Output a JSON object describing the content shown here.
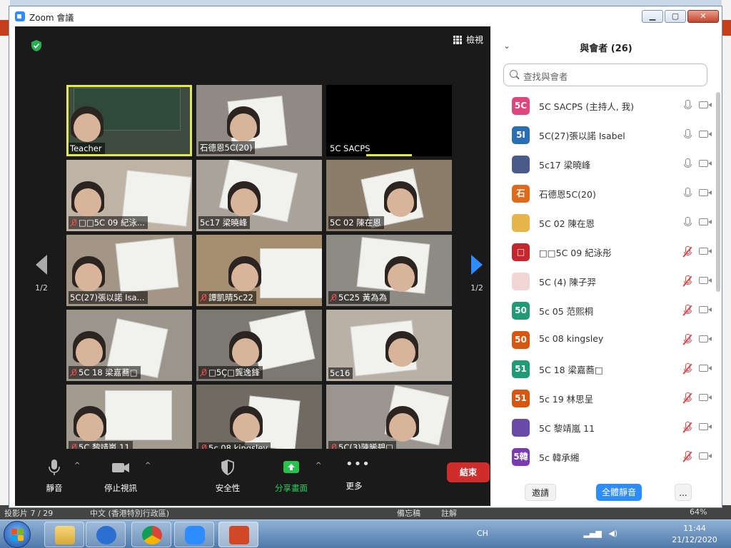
{
  "window": {
    "title": "Zoom 會議"
  },
  "stage": {
    "view_label": "檢視",
    "page_left": "1/2",
    "page_right": "1/2",
    "tiles": [
      {
        "name": "Teacher",
        "muted": false,
        "bg": "#3d4c3f"
      },
      {
        "name": "石德恩5C(20)",
        "muted": false,
        "bg": "#8f8a84"
      },
      {
        "name": "5C SACPS",
        "muted": false,
        "bg": "#000000"
      },
      {
        "name": "□□5C 09 紀泳...",
        "muted": true,
        "bg": "#bfb3a6"
      },
      {
        "name": "5c17 梁曉峰",
        "muted": false,
        "bg": "#a9a39a"
      },
      {
        "name": "5C 02 陳在恩",
        "muted": false,
        "bg": "#8c7c6a"
      },
      {
        "name": "5C(27)張以諾 Isa...",
        "muted": false,
        "bg": "#a49684"
      },
      {
        "name": "譚凱晴5c22",
        "muted": true,
        "bg": "#a68e70"
      },
      {
        "name": "5C25 黃為為",
        "muted": true,
        "bg": "#8d8b83"
      },
      {
        "name": "5C 18 梁嘉蕎□",
        "muted": true,
        "bg": "#9c958c"
      },
      {
        "name": "□5Ç□龔逸鋒",
        "muted": true,
        "bg": "#7c7872"
      },
      {
        "name": "5c16",
        "muted": false,
        "bg": "#b9b1a6"
      },
      {
        "name": "5C 黎靖嵐 11",
        "muted": true,
        "bg": "#a39a90"
      },
      {
        "name": "5c 08 kingsley",
        "muted": true,
        "bg": "#6f6a62"
      },
      {
        "name": "5C(3)陳晞碧□",
        "muted": true,
        "bg": "#9a958e"
      }
    ]
  },
  "toolbar": {
    "mute": "靜音",
    "stop_video": "停止視訊",
    "security": "安全性",
    "share": "分享畫面",
    "more": "更多",
    "end": "結束"
  },
  "panel": {
    "title": "與會者 (26)",
    "search_placeholder": "查找與會者",
    "participants": [
      {
        "avatar": "5C",
        "color": "#e0457b",
        "name": "5C SACPS (主持人, 我)",
        "muted": false
      },
      {
        "avatar": "5I",
        "color": "#2a6fb3",
        "name": "5C(27)張以諾 Isabel",
        "muted": false
      },
      {
        "avatar": "",
        "color": "#4a5a8a",
        "name": "5c17 梁曉峰",
        "muted": false
      },
      {
        "avatar": "石",
        "color": "#e06a1b",
        "name": "石德恩5C(20)",
        "muted": false
      },
      {
        "avatar": "",
        "color": "#e8b54a",
        "name": "5C 02 陳在恩",
        "muted": false
      },
      {
        "avatar": "□",
        "color": "#c8262e",
        "name": "□□5C 09 紀泳彤",
        "muted": true
      },
      {
        "avatar": "",
        "color": "#f2d6d6",
        "name": "5C (4) 陳子羿",
        "muted": true
      },
      {
        "avatar": "50",
        "color": "#1f9c75",
        "name": "5c 05 范熙桐",
        "muted": true
      },
      {
        "avatar": "50",
        "color": "#d8560f",
        "name": "5c 08 kingsley",
        "muted": true
      },
      {
        "avatar": "51",
        "color": "#1f9c75",
        "name": "5C 18 梁嘉蕎□",
        "muted": true
      },
      {
        "avatar": "51",
        "color": "#d8560f",
        "name": "5c 19 林思呈",
        "muted": true
      },
      {
        "avatar": "",
        "color": "#6a4aa8",
        "name": "5C 黎靖嵐 11",
        "muted": true
      },
      {
        "avatar": "5韓",
        "color": "#7a3ab0",
        "name": "5c 韓承緗",
        "muted": true
      }
    ],
    "invite": "邀請",
    "mute_all": "全體靜音",
    "more": "..."
  },
  "background": {
    "status_left": "投影片 7 / 29",
    "status_lang": "中文 (香港特別行政區)",
    "status_notes": "備忘稿",
    "status_comments": "註解",
    "status_zoom": "64%"
  },
  "taskbar": {
    "lang": "CH",
    "time": "11:44",
    "date": "21/12/2020"
  }
}
